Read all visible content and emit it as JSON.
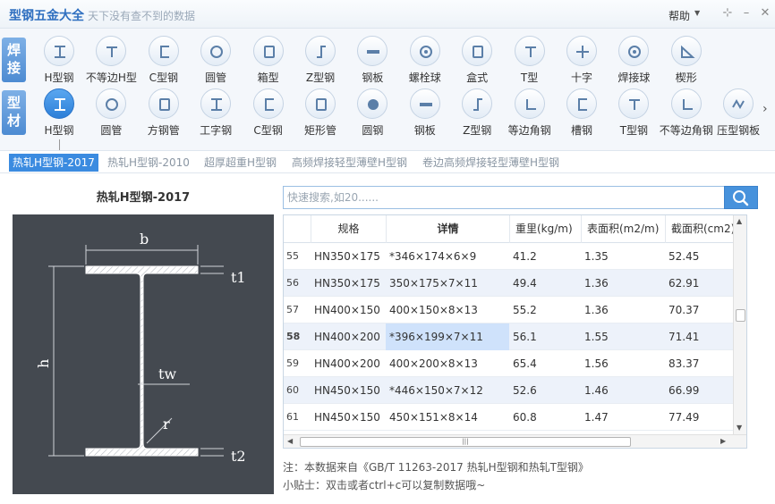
{
  "app": {
    "title": "型钢五金大全",
    "slogan": "天下没有查不到的数据",
    "help": "帮助"
  },
  "rows": {
    "weld_label": "焊接",
    "steel_label": "型材",
    "weld_items": [
      {
        "label": "H型钢",
        "icon": "h-beam-icon"
      },
      {
        "label": "不等边H型",
        "icon": "t-beam-icon"
      },
      {
        "label": "C型钢",
        "icon": "c-channel-icon"
      },
      {
        "label": "圆管",
        "icon": "round-tube-icon"
      },
      {
        "label": "箱型",
        "icon": "box-section-icon"
      },
      {
        "label": "Z型钢",
        "icon": "z-section-icon"
      },
      {
        "label": "钢板",
        "icon": "steel-plate-icon"
      },
      {
        "label": "螺栓球",
        "icon": "bolt-ball-icon"
      },
      {
        "label": "盒式",
        "icon": "box-type-icon"
      },
      {
        "label": "T型",
        "icon": "t-section-icon"
      },
      {
        "label": "十字",
        "icon": "cross-section-icon"
      },
      {
        "label": "焊接球",
        "icon": "welded-ball-icon"
      },
      {
        "label": "楔形",
        "icon": "wedge-icon"
      }
    ],
    "steel_items": [
      {
        "label": "H型钢",
        "icon": "h-beam-icon"
      },
      {
        "label": "圆管",
        "icon": "round-tube-icon"
      },
      {
        "label": "方钢管",
        "icon": "square-tube-icon"
      },
      {
        "label": "工字钢",
        "icon": "i-beam-icon"
      },
      {
        "label": "C型钢",
        "icon": "c-channel-icon"
      },
      {
        "label": "矩形管",
        "icon": "rect-tube-icon"
      },
      {
        "label": "圆钢",
        "icon": "round-bar-icon"
      },
      {
        "label": "钢板",
        "icon": "steel-plate-icon"
      },
      {
        "label": "Z型钢",
        "icon": "z-section-icon"
      },
      {
        "label": "等边角钢",
        "icon": "equal-angle-icon"
      },
      {
        "label": "槽钢",
        "icon": "channel-icon"
      },
      {
        "label": "T型钢",
        "icon": "t-section-icon"
      },
      {
        "label": "不等边角钢",
        "icon": "unequal-angle-icon"
      },
      {
        "label": "压型钢板",
        "icon": "profiled-sheet-icon"
      }
    ]
  },
  "subtabs": [
    "热轧H型钢-2017",
    "热轧H型钢-2010",
    "超厚超重H型钢",
    "高频焊接轻型薄壁H型钢",
    "卷边高频焊接轻型薄壁H型钢"
  ],
  "diagram": {
    "title": "热轧H型钢-2017",
    "labels": {
      "b": "b",
      "t1": "t1",
      "h": "h",
      "tw": "tw",
      "r": "r",
      "t2": "t2"
    }
  },
  "search": {
    "placeholder": "快速搜索,如20......"
  },
  "table": {
    "headers": [
      "规格",
      "详情",
      "重里(kg/m)",
      "表面积(m2/m)",
      "截面积(cm2)"
    ],
    "rows": [
      {
        "idx": "55",
        "spec": "HN350×175",
        "detail": "*346×174×6×9",
        "weight": "41.2",
        "surface": "1.35",
        "area": "52.45"
      },
      {
        "idx": "56",
        "spec": "HN350×175",
        "detail": "350×175×7×11",
        "weight": "49.4",
        "surface": "1.36",
        "area": "62.91"
      },
      {
        "idx": "57",
        "spec": "HN400×150",
        "detail": "400×150×8×13",
        "weight": "55.2",
        "surface": "1.36",
        "area": "70.37"
      },
      {
        "idx": "58",
        "spec": "HN400×200",
        "detail": "*396×199×7×11",
        "weight": "56.1",
        "surface": "1.55",
        "area": "71.41"
      },
      {
        "idx": "59",
        "spec": "HN400×200",
        "detail": "400×200×8×13",
        "weight": "65.4",
        "surface": "1.56",
        "area": "83.37"
      },
      {
        "idx": "60",
        "spec": "HN450×150",
        "detail": "*446×150×7×12",
        "weight": "52.6",
        "surface": "1.46",
        "area": "66.99"
      },
      {
        "idx": "61",
        "spec": "HN450×150",
        "detail": "450×151×8×14",
        "weight": "60.8",
        "surface": "1.47",
        "area": "77.49"
      }
    ]
  },
  "footer": {
    "note": "注：本数据来自《GB/T 11263-2017 热轧H型钢和热轧T型钢》",
    "tip": "小贴士：双击或者ctrl+c可以复制数据哦~"
  },
  "colors": {
    "accent": "#3b8be0",
    "diagram_bg": "#444950",
    "row_alt": "#edf2fa",
    "selected": "#cfe2fb"
  }
}
